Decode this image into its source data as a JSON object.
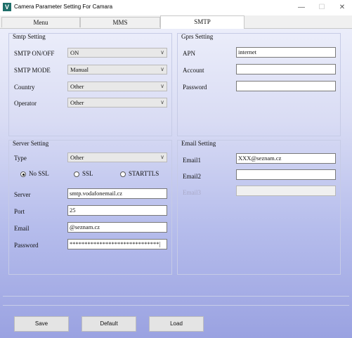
{
  "window": {
    "title": "Camera Parameter Setting For  Camara",
    "icon_letter": "V",
    "minimize_glyph": "—",
    "maximize_glyph": "☐",
    "close_glyph": "✕"
  },
  "tabs": [
    "Menu",
    "MMS",
    "SMTP"
  ],
  "active_tab": "SMTP",
  "smtp_setting": {
    "title": "Smtp Setting",
    "rows": [
      {
        "label": "SMTP ON/OFF",
        "value": "ON"
      },
      {
        "label": "SMTP MODE",
        "value": "Manual"
      },
      {
        "label": "Country",
        "value": "Other"
      },
      {
        "label": "Operator",
        "value": "Other"
      }
    ]
  },
  "gprs_setting": {
    "title": "Gprs Setting",
    "apn_label": "APN",
    "apn_value": "internet",
    "account_label": "Account",
    "account_value": "",
    "password_label": "Password",
    "password_value": ""
  },
  "server_setting": {
    "title": "Server Setting",
    "type_label": "Type",
    "type_value": "Other",
    "ssl_options": [
      "No SSL",
      "SSL",
      "STARTTLS"
    ],
    "ssl_selected": "No SSL",
    "server_label": "Server",
    "server_value": "smtp.vodafonemail.cz",
    "port_label": "Port",
    "port_value": "25",
    "email_label": "Email",
    "email_value": "@seznam.cz",
    "password_label": "Password",
    "password_value": "******************************|"
  },
  "email_setting": {
    "title": "Email Setting",
    "email1_label": "Email1",
    "email1_value": "XXX@seznam.cz",
    "email2_label": "Email2",
    "email2_value": "",
    "email3_label": "Email3",
    "email3_value": ""
  },
  "buttons": {
    "save": "Save",
    "default": "Default",
    "load": "Load"
  },
  "icons": {
    "dropdown": "chevron-down-icon"
  }
}
